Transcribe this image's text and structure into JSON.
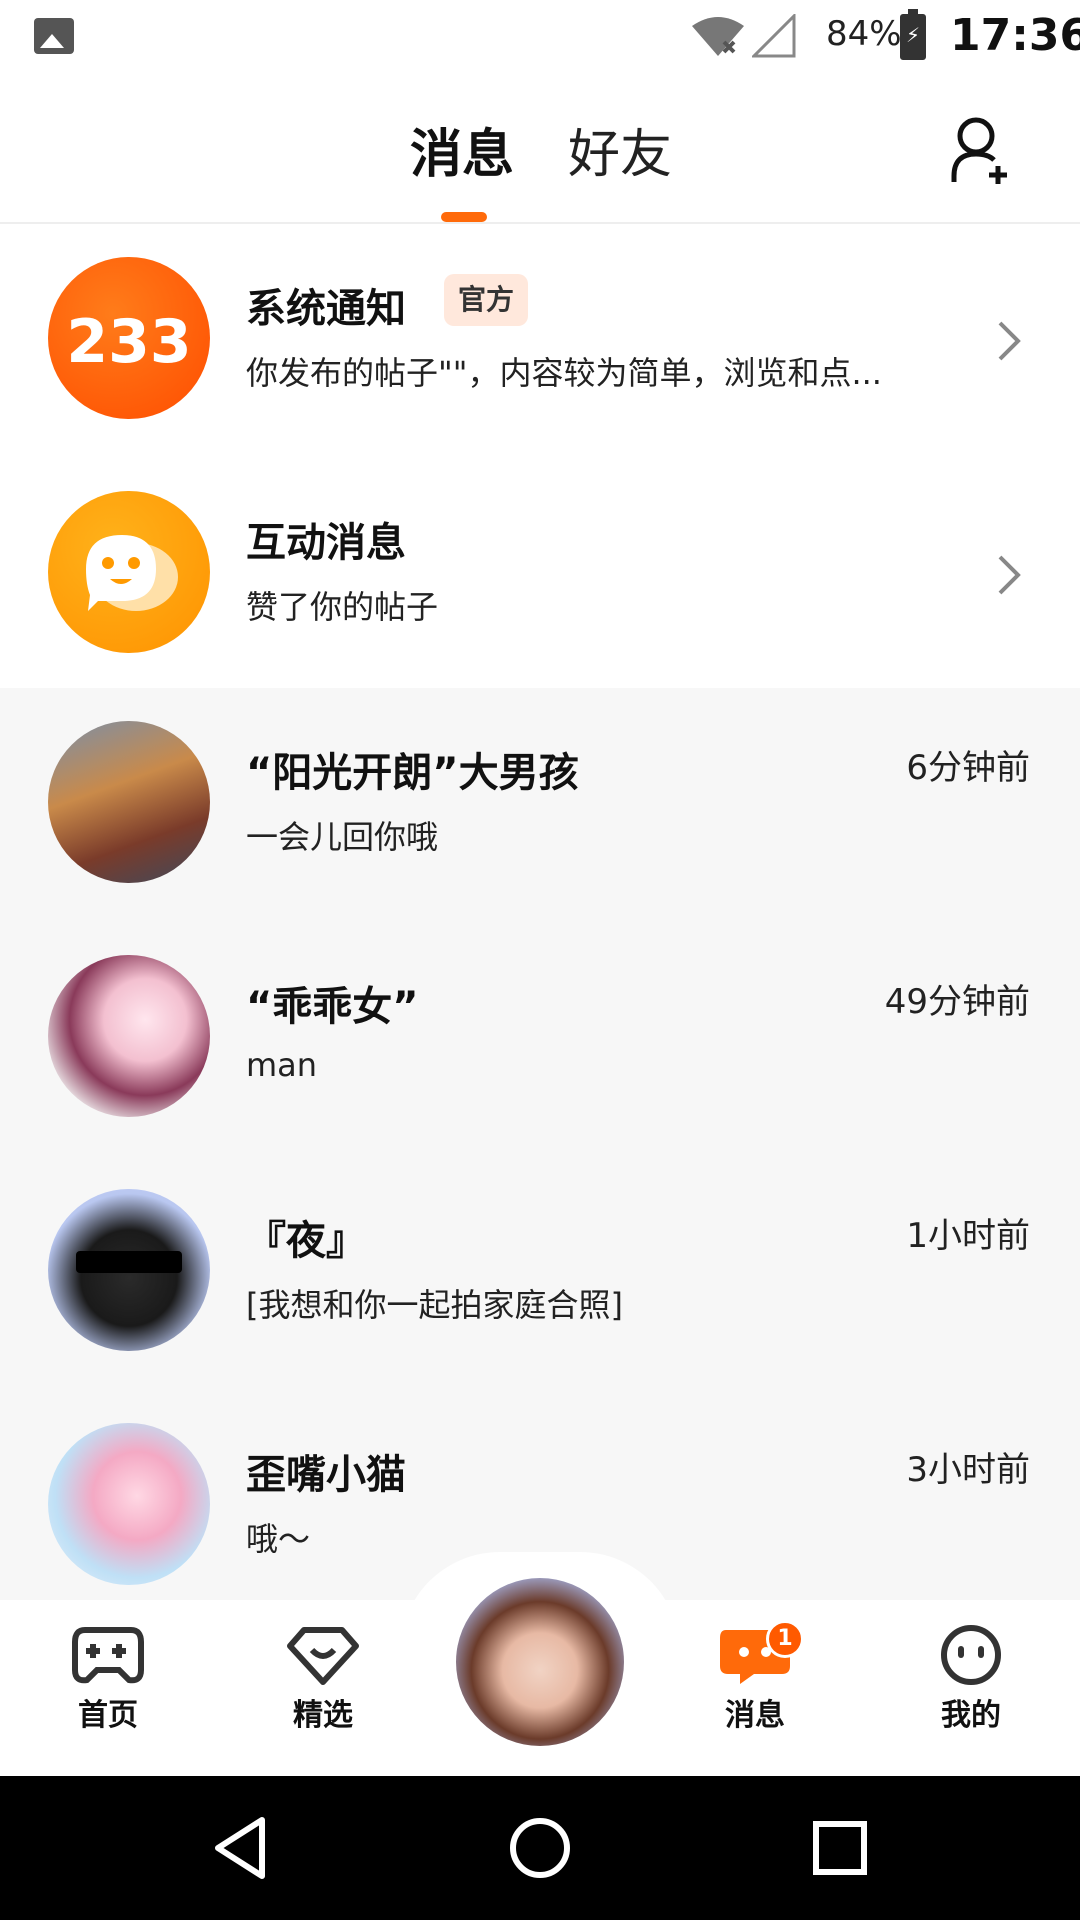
{
  "status_bar": {
    "battery_percent": "84%",
    "time": "17:36"
  },
  "header": {
    "tabs": [
      {
        "label": "消息",
        "active": true
      },
      {
        "label": "好友",
        "active": false
      }
    ],
    "accent_color": "#ff6a0a"
  },
  "pinned": [
    {
      "title": "系统通知",
      "badge": "官方",
      "subtitle": "你发布的帖子\"\"，内容较为简单，浏览和点...",
      "avatar_text": "233"
    },
    {
      "title": "互动消息",
      "subtitle": "赞了你的帖子"
    }
  ],
  "chats": [
    {
      "name": "“阳光开朗”大男孩",
      "message": "一会儿回你哦",
      "time": "6分钟前"
    },
    {
      "name": "“乖乖女”",
      "message": "man",
      "time": "49分钟前"
    },
    {
      "name": "『夜』",
      "message": "[我想和你一起拍家庭合照]",
      "time": "1小时前"
    },
    {
      "name": "歪嘴小猫",
      "message": "哦～",
      "time": "3小时前"
    }
  ],
  "bottom_nav": {
    "items": [
      {
        "label": "首页",
        "icon": "gamepad-icon"
      },
      {
        "label": "精选",
        "icon": "heart-diamond-icon"
      },
      {
        "label": "消息",
        "icon": "chat-bubble-icon",
        "badge": "1"
      },
      {
        "label": "我的",
        "icon": "smiley-face-icon"
      }
    ]
  }
}
